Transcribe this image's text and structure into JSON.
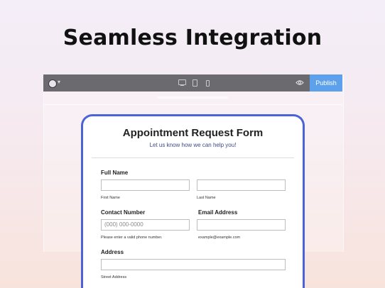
{
  "headline": "Seamless Integration",
  "toolbar": {
    "publish_label": "Publish",
    "icons": [
      "logo-icon",
      "chevron-down-icon",
      "desktop-icon",
      "tablet-icon",
      "mobile-icon",
      "eye-icon"
    ],
    "accent_color": "#5da1ec"
  },
  "form": {
    "title": "Appointment Request Form",
    "subtitle": "Let us know how we can help you!",
    "full_name": {
      "label": "Full Name",
      "first_hint": "First Name",
      "last_hint": "Last Name"
    },
    "contact": {
      "label": "Contact Number",
      "placeholder": "(000) 000-0000",
      "hint": "Please enter a valid phone number."
    },
    "email": {
      "label": "Email Address",
      "hint": "example@example.com"
    },
    "address": {
      "label": "Address",
      "street_hint": "Street Address"
    },
    "border_color": "#4a63d6"
  }
}
